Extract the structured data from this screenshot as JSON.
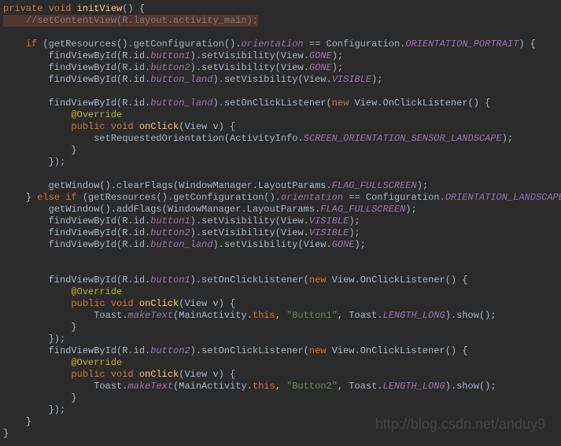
{
  "code_lines": [
    {
      "cls": "",
      "tokens": [
        {
          "t": "private void ",
          "c": "kw"
        },
        {
          "t": "initView",
          "c": "method"
        },
        {
          "t": "() {",
          "c": ""
        }
      ]
    },
    {
      "cls": "hl",
      "tokens": [
        {
          "t": "    //setContentView(R.layout.activity_main);",
          "c": "comment"
        }
      ]
    },
    {
      "cls": "",
      "tokens": [
        {
          "t": "",
          "c": ""
        }
      ]
    },
    {
      "cls": "",
      "tokens": [
        {
          "t": "    if ",
          "c": "kw"
        },
        {
          "t": "(getResources().getConfiguration().",
          "c": ""
        },
        {
          "t": "orientation",
          "c": "field"
        },
        {
          "t": " == Configuration.",
          "c": ""
        },
        {
          "t": "ORIENTATION_PORTRAIT",
          "c": "field"
        },
        {
          "t": ") {",
          "c": ""
        }
      ]
    },
    {
      "cls": "",
      "tokens": [
        {
          "t": "        findViewById(R.id.",
          "c": ""
        },
        {
          "t": "button1",
          "c": "field"
        },
        {
          "t": ").setVisibility(View.",
          "c": ""
        },
        {
          "t": "GONE",
          "c": "field"
        },
        {
          "t": ");",
          "c": ""
        }
      ]
    },
    {
      "cls": "",
      "tokens": [
        {
          "t": "        findViewById(R.id.",
          "c": ""
        },
        {
          "t": "button2",
          "c": "field"
        },
        {
          "t": ").setVisibility(View.",
          "c": ""
        },
        {
          "t": "GONE",
          "c": "field"
        },
        {
          "t": ");",
          "c": ""
        }
      ]
    },
    {
      "cls": "",
      "tokens": [
        {
          "t": "        findViewById(R.id.",
          "c": ""
        },
        {
          "t": "button_land",
          "c": "field"
        },
        {
          "t": ").setVisibility(View.",
          "c": ""
        },
        {
          "t": "VISIBLE",
          "c": "field"
        },
        {
          "t": ");",
          "c": ""
        }
      ]
    },
    {
      "cls": "",
      "tokens": [
        {
          "t": "",
          "c": ""
        }
      ]
    },
    {
      "cls": "",
      "tokens": [
        {
          "t": "        findViewById(R.id.",
          "c": ""
        },
        {
          "t": "button_land",
          "c": "field"
        },
        {
          "t": ").setOnClickListener(",
          "c": ""
        },
        {
          "t": "new ",
          "c": "kw"
        },
        {
          "t": "View.OnClickListener() {",
          "c": ""
        }
      ]
    },
    {
      "cls": "",
      "tokens": [
        {
          "t": "            @Override",
          "c": "anno"
        }
      ]
    },
    {
      "cls": "",
      "tokens": [
        {
          "t": "            public void ",
          "c": "kw"
        },
        {
          "t": "onClick",
          "c": "method"
        },
        {
          "t": "(View v) {",
          "c": ""
        }
      ]
    },
    {
      "cls": "",
      "tokens": [
        {
          "t": "                setRequestedOrientation(ActivityInfo.",
          "c": ""
        },
        {
          "t": "SCREEN_ORIENTATION_SENSOR_LANDSCAPE",
          "c": "field"
        },
        {
          "t": ");",
          "c": ""
        }
      ]
    },
    {
      "cls": "",
      "tokens": [
        {
          "t": "            }",
          "c": ""
        }
      ]
    },
    {
      "cls": "",
      "tokens": [
        {
          "t": "        });",
          "c": ""
        }
      ]
    },
    {
      "cls": "",
      "tokens": [
        {
          "t": "",
          "c": ""
        }
      ]
    },
    {
      "cls": "",
      "tokens": [
        {
          "t": "        getWindow().clearFlags(WindowManager.LayoutParams.",
          "c": ""
        },
        {
          "t": "FLAG_FULLSCREEN",
          "c": "field"
        },
        {
          "t": ");",
          "c": ""
        }
      ]
    },
    {
      "cls": "",
      "tokens": [
        {
          "t": "    } ",
          "c": ""
        },
        {
          "t": "else if ",
          "c": "kw"
        },
        {
          "t": "(getResources().getConfiguration().",
          "c": ""
        },
        {
          "t": "orientation",
          "c": "field"
        },
        {
          "t": " == Configuration.",
          "c": ""
        },
        {
          "t": "ORIENTATION_LANDSCAPE",
          "c": "field"
        },
        {
          "t": ")",
          "c": ""
        }
      ]
    },
    {
      "cls": "",
      "tokens": [
        {
          "t": "        getWindow().addFlags(WindowManager.LayoutParams.",
          "c": ""
        },
        {
          "t": "FLAG_FULLSCREEN",
          "c": "field"
        },
        {
          "t": ");",
          "c": ""
        }
      ]
    },
    {
      "cls": "",
      "tokens": [
        {
          "t": "        findViewById(R.id.",
          "c": ""
        },
        {
          "t": "button1",
          "c": "field"
        },
        {
          "t": ").setVisibility(View.",
          "c": ""
        },
        {
          "t": "VISIBLE",
          "c": "field"
        },
        {
          "t": ");",
          "c": ""
        }
      ]
    },
    {
      "cls": "",
      "tokens": [
        {
          "t": "        findViewById(R.id.",
          "c": ""
        },
        {
          "t": "button2",
          "c": "field"
        },
        {
          "t": ").setVisibility(View.",
          "c": ""
        },
        {
          "t": "VISIBLE",
          "c": "field"
        },
        {
          "t": ");",
          "c": ""
        }
      ]
    },
    {
      "cls": "",
      "tokens": [
        {
          "t": "        findViewById(R.id.",
          "c": ""
        },
        {
          "t": "button_land",
          "c": "field"
        },
        {
          "t": ").setVisibility(View.",
          "c": ""
        },
        {
          "t": "GONE",
          "c": "field"
        },
        {
          "t": ");",
          "c": ""
        }
      ]
    },
    {
      "cls": "",
      "tokens": [
        {
          "t": "",
          "c": ""
        }
      ]
    },
    {
      "cls": "",
      "tokens": [
        {
          "t": "",
          "c": ""
        }
      ]
    },
    {
      "cls": "",
      "tokens": [
        {
          "t": "        findViewById(R.id.",
          "c": ""
        },
        {
          "t": "button1",
          "c": "field"
        },
        {
          "t": ").setOnClickListener(",
          "c": ""
        },
        {
          "t": "new ",
          "c": "kw"
        },
        {
          "t": "View.OnClickListener() {",
          "c": ""
        }
      ]
    },
    {
      "cls": "",
      "tokens": [
        {
          "t": "            @Override",
          "c": "anno"
        }
      ]
    },
    {
      "cls": "",
      "tokens": [
        {
          "t": "            public void ",
          "c": "kw"
        },
        {
          "t": "onClick",
          "c": "method"
        },
        {
          "t": "(View v) {",
          "c": ""
        }
      ]
    },
    {
      "cls": "",
      "tokens": [
        {
          "t": "                Toast.",
          "c": ""
        },
        {
          "t": "makeText",
          "c": "field"
        },
        {
          "t": "(MainActivity.",
          "c": ""
        },
        {
          "t": "this",
          "c": "kw"
        },
        {
          "t": ", ",
          "c": ""
        },
        {
          "t": "\"Button1\"",
          "c": "str"
        },
        {
          "t": ", Toast.",
          "c": ""
        },
        {
          "t": "LENGTH_LONG",
          "c": "field"
        },
        {
          "t": ").show();",
          "c": ""
        }
      ]
    },
    {
      "cls": "",
      "tokens": [
        {
          "t": "            }",
          "c": ""
        }
      ]
    },
    {
      "cls": "",
      "tokens": [
        {
          "t": "        });",
          "c": ""
        }
      ]
    },
    {
      "cls": "",
      "tokens": [
        {
          "t": "        findViewById(R.id.",
          "c": ""
        },
        {
          "t": "button2",
          "c": "field"
        },
        {
          "t": ").setOnClickListener(",
          "c": ""
        },
        {
          "t": "new ",
          "c": "kw"
        },
        {
          "t": "View.OnClickListener() {",
          "c": ""
        }
      ]
    },
    {
      "cls": "",
      "tokens": [
        {
          "t": "            @Override",
          "c": "anno"
        }
      ]
    },
    {
      "cls": "",
      "tokens": [
        {
          "t": "            public void ",
          "c": "kw"
        },
        {
          "t": "onClick",
          "c": "method"
        },
        {
          "t": "(View v) {",
          "c": ""
        }
      ]
    },
    {
      "cls": "",
      "tokens": [
        {
          "t": "                Toast.",
          "c": ""
        },
        {
          "t": "makeText",
          "c": "field"
        },
        {
          "t": "(MainActivity.",
          "c": ""
        },
        {
          "t": "this",
          "c": "kw"
        },
        {
          "t": ", ",
          "c": ""
        },
        {
          "t": "\"Button2\"",
          "c": "str"
        },
        {
          "t": ", Toast.",
          "c": ""
        },
        {
          "t": "LENGTH_LONG",
          "c": "field"
        },
        {
          "t": ").show();",
          "c": ""
        }
      ]
    },
    {
      "cls": "",
      "tokens": [
        {
          "t": "            }",
          "c": ""
        }
      ]
    },
    {
      "cls": "",
      "tokens": [
        {
          "t": "        });",
          "c": ""
        }
      ]
    },
    {
      "cls": "",
      "tokens": [
        {
          "t": "    }",
          "c": ""
        }
      ]
    },
    {
      "cls": "",
      "tokens": [
        {
          "t": "}",
          "c": ""
        }
      ]
    }
  ],
  "watermark": "http://blog.csdn.net/anduy9"
}
